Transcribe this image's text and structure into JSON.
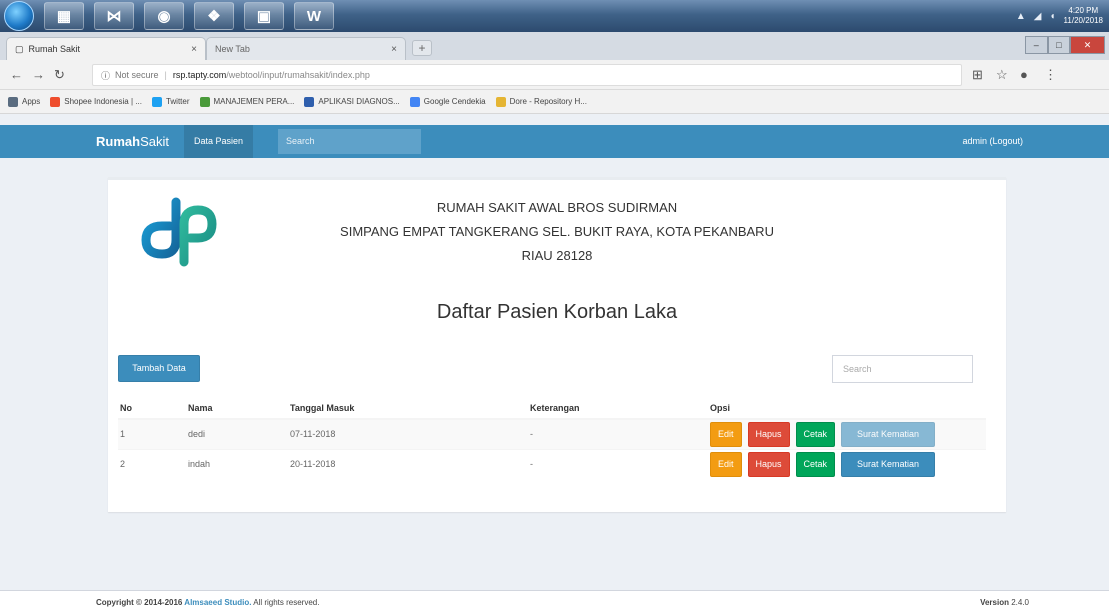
{
  "browser": {
    "tabs": [
      {
        "title": "Rumah Sakit",
        "close": "×"
      },
      {
        "title": "New Tab",
        "close": "×"
      }
    ],
    "new_tab": "+",
    "address": {
      "security": "Not secure",
      "host": "rsp.tapty.com",
      "path": "/webtool/input/rumahsakit/index.php"
    },
    "bookmarks": [
      {
        "label": "Apps",
        "color": "#5a6c80"
      },
      {
        "label": "Shopee Indonesia | ...",
        "color": "#ee4d2d"
      },
      {
        "label": "Twitter",
        "color": "#1da1f2"
      },
      {
        "label": "MANAJEMEN PERA...",
        "color": "#4a9a3a"
      },
      {
        "label": "APLIKASI DIAGNOS...",
        "color": "#2f5fad"
      },
      {
        "label": "Google Cendekia",
        "color": "#4285f4"
      },
      {
        "label": "Dore - Repository H...",
        "color": "#e5b533"
      }
    ]
  },
  "taskbar": {
    "clock_time": "4:20 PM",
    "clock_date": "11/20/2018"
  },
  "navbar": {
    "brand_bold": "Rumah",
    "brand_rest": "Sakit",
    "link": "Data Pasien",
    "search_placeholder": "Search",
    "user": "admin (Logout)"
  },
  "header": {
    "line1": "RUMAH SAKIT AWAL BROS SUDIRMAN",
    "line2": "SIMPANG EMPAT TANGKERANG SEL. BUKIT RAYA, KOTA PEKANBARU",
    "line3": "RIAU 28128",
    "title": "Daftar Pasien Korban Laka"
  },
  "toolbar": {
    "add_label": "Tambah Data",
    "search_placeholder": "Search"
  },
  "table": {
    "columns": [
      "No",
      "Nama",
      "Tanggal Masuk",
      "Keterangan",
      "Opsi"
    ],
    "rows": [
      {
        "no": "1",
        "nama": "dedi",
        "tanggal": "07-11-2018",
        "keterangan": "-"
      },
      {
        "no": "2",
        "nama": "indah",
        "tanggal": "20-11-2018",
        "keterangan": "-"
      }
    ],
    "actions": {
      "edit": "Edit",
      "delete": "Hapus",
      "print": "Cetak",
      "letter": "Surat Kematian"
    }
  },
  "footer": {
    "copyright_prefix": "Copyright © 2014-2016 ",
    "company": "Almsaeed Studio.",
    "suffix": " All rights reserved.",
    "version_label": "Version",
    "version": "2.4.0"
  },
  "colors": {
    "primary": "#3c8dbc",
    "warning": "#f39c12",
    "danger": "#dd4b39",
    "success": "#00a65a"
  }
}
